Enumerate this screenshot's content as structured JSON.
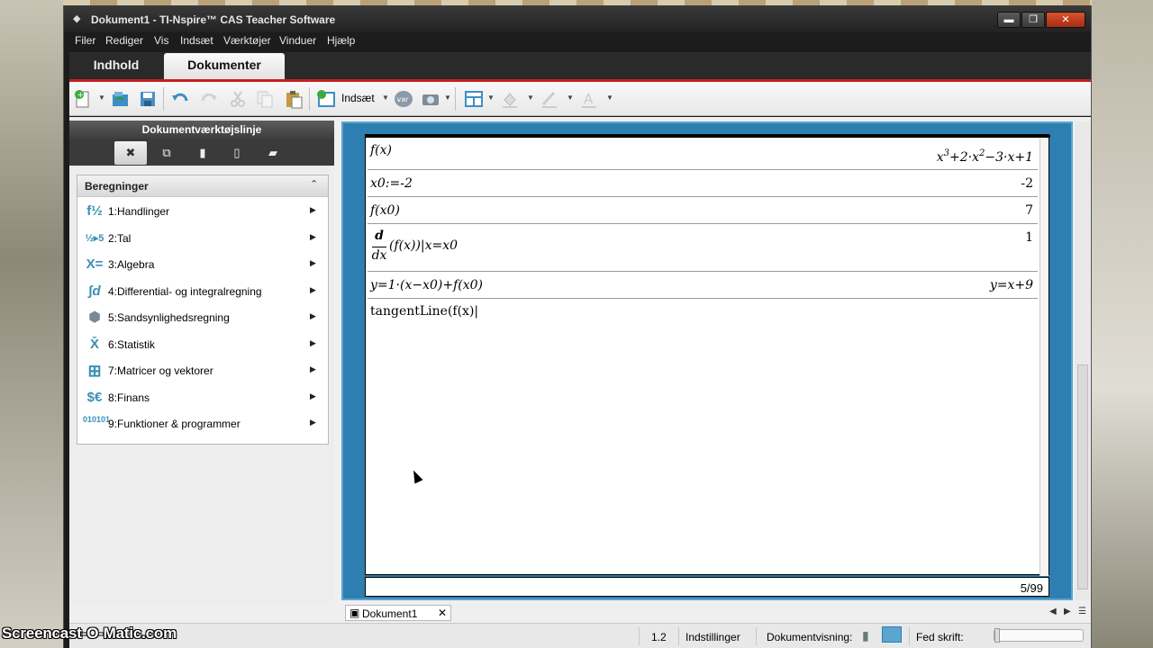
{
  "window": {
    "title": "Dokument1 - TI-Nspire™ CAS Teacher Software",
    "buttons": {
      "minimize": "▬",
      "maximize": "❐",
      "close": "✕"
    }
  },
  "menu": [
    "Filer",
    "Rediger",
    "Vis",
    "Indsæt",
    "Værktøjer",
    "Vinduer",
    "Hjælp"
  ],
  "tabs": {
    "content": "Indhold",
    "documents": "Dokumenter"
  },
  "toolbar": {
    "insert_label": "Indsæt",
    "icons": [
      "new-document-icon",
      "open-icon",
      "save-icon",
      "undo-icon",
      "redo-icon",
      "cut-icon",
      "copy-icon",
      "paste-icon",
      "insert-page-icon",
      "variable-icon",
      "screenshot-icon",
      "table-layout-icon",
      "fill-color-icon",
      "line-color-icon",
      "text-color-icon"
    ]
  },
  "left_panel": {
    "title": "Dokumentværktøjslinje",
    "section_title": "Beregninger",
    "items": [
      {
        "icon": "f½",
        "label": "1:Handlinger"
      },
      {
        "icon": "½▸5",
        "label": "2:Tal"
      },
      {
        "icon": "X=",
        "label": "3:Algebra"
      },
      {
        "icon": "∫d",
        "label": "4:Differential- og integralregning"
      },
      {
        "icon": "⬢",
        "label": "5:Sandsynlighedsregning"
      },
      {
        "icon": "X̄",
        "label": "6:Statistik"
      },
      {
        "icon": "⊞",
        "label": "7:Matricer og vektorer"
      },
      {
        "icon": "$€",
        "label": "8:Finans"
      },
      {
        "icon": "010101",
        "label": "9:Funktioner & programmer"
      }
    ]
  },
  "calculator": {
    "rows": [
      {
        "input": "f(x)",
        "output_main": "x",
        "output_exp1": "3",
        "output_mid": "+2·x",
        "output_exp2": "2",
        "output_tail": "−3·x+1"
      },
      {
        "input": "x0:=-2",
        "output": "-2"
      },
      {
        "input": "f(x0)",
        "output": "7"
      },
      {
        "input_num": "d",
        "input_den": "dx",
        "input_rest": "(f(x))|x=x0",
        "output": "1"
      },
      {
        "input": "y=1·(x−x0)+f(x0)",
        "output": "y=x+9"
      }
    ],
    "current_entry": "tangentLine(f(x)|",
    "page_count": "5/99"
  },
  "doc_tab": {
    "label": "Dokument1",
    "close": "✕"
  },
  "statusbar": {
    "page": "1.2",
    "settings": "Indstillinger",
    "doc_view": "Dokumentvisning:",
    "bold": "Fed skrift:"
  },
  "watermark": "Screencast-O-Matic.com",
  "colors": {
    "accent_red": "#c61f1f",
    "frame_blue": "#2e7fb1",
    "icon_teal": "#3a8fb5"
  }
}
